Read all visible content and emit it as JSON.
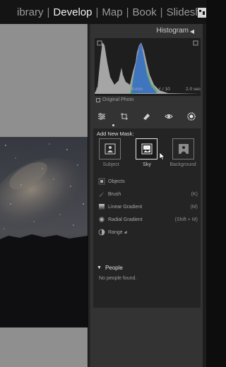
{
  "modules": {
    "library": "ibrary",
    "develop": "Develop",
    "map": "Map",
    "book": "Book",
    "slideshow": "Slideshow"
  },
  "histogram": {
    "title": "Histogram",
    "iso": "ISO 400",
    "focal": "24 mm",
    "aperture": "ƒ / 10",
    "shutter": "2.0 sec",
    "original_photo": "Original Photo"
  },
  "tools": [
    "sliders-icon",
    "crop-icon",
    "heal-icon",
    "eye-icon",
    "masking-icon"
  ],
  "masking": {
    "title": "Add New Mask:",
    "buttons": [
      {
        "label": "Subject",
        "icon": "person-icon",
        "selected": false
      },
      {
        "label": "Sky",
        "icon": "sky-icon",
        "selected": true
      },
      {
        "label": "Background",
        "icon": "background-icon",
        "selected": false
      }
    ],
    "rows": [
      {
        "label": "Objects",
        "shortcut": "",
        "icon": "objects-icon"
      },
      {
        "label": "Brush",
        "shortcut": "(K)",
        "icon": "brush-icon"
      },
      {
        "label": "Linear Gradient",
        "shortcut": "(M)",
        "icon": "linear-gradient-icon"
      },
      {
        "label": "Radial Gradient",
        "shortcut": "(Shift + M)",
        "icon": "radial-gradient-icon"
      },
      {
        "label": "Range",
        "shortcut": "",
        "icon": "range-icon"
      }
    ]
  },
  "people": {
    "title": "People",
    "empty": "No people found."
  }
}
